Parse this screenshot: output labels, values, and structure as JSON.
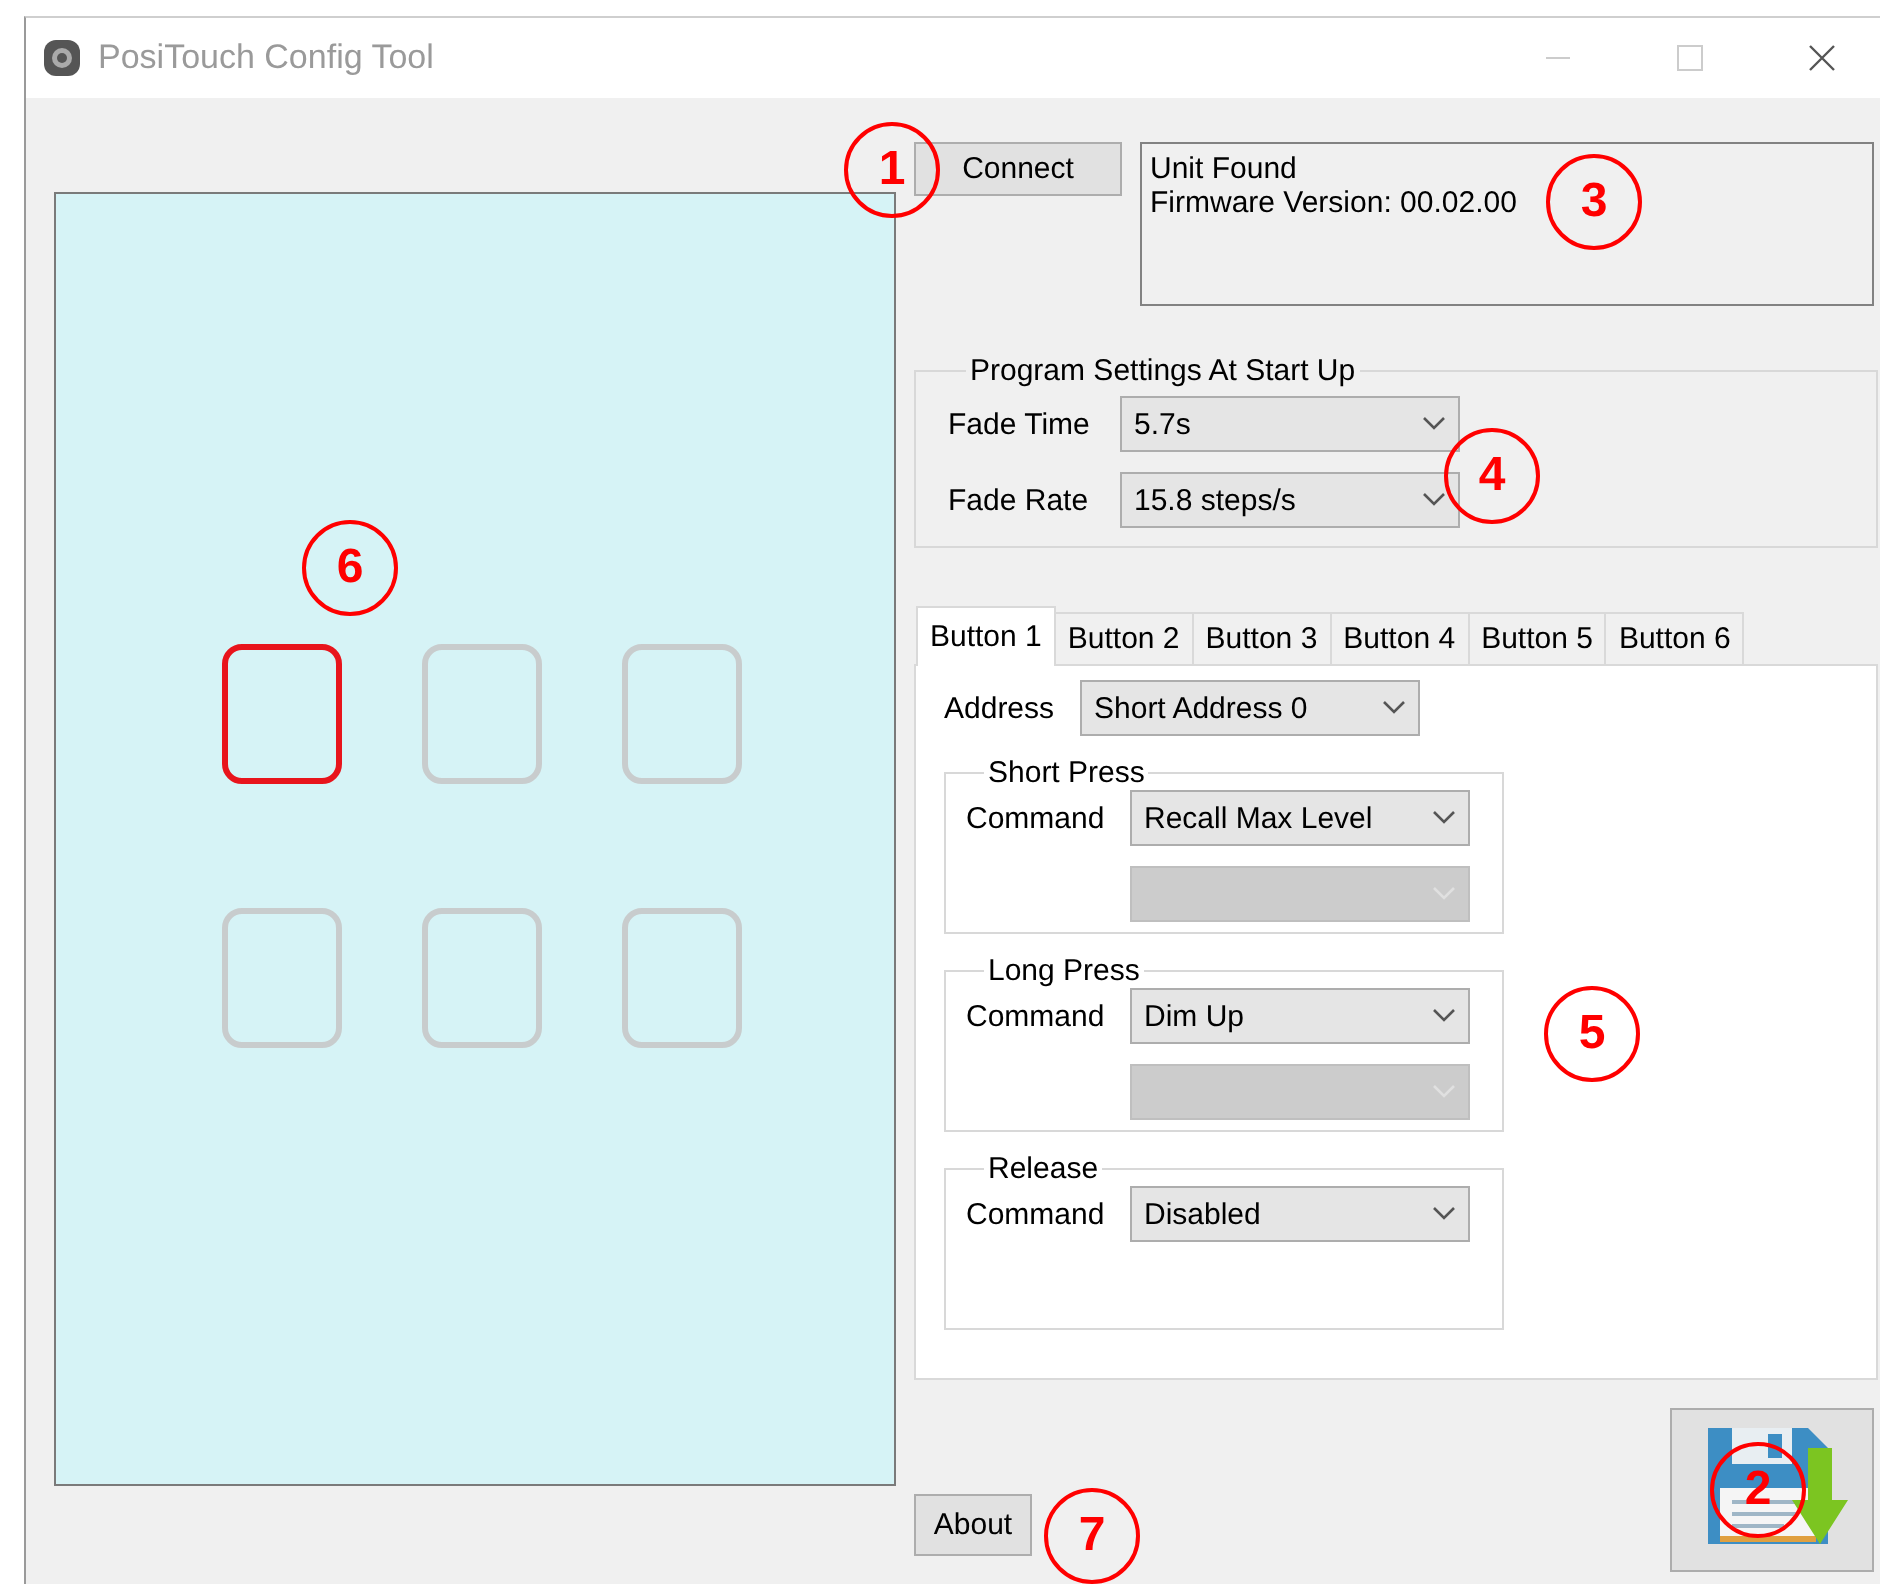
{
  "window": {
    "title": "PosiTouch Config Tool"
  },
  "preview": {
    "buttons": [
      {
        "selected": true
      },
      {
        "selected": false
      },
      {
        "selected": false
      },
      {
        "selected": false
      },
      {
        "selected": false
      },
      {
        "selected": false
      }
    ]
  },
  "connect_button": "Connect",
  "status": {
    "lines": [
      "Unit Found",
      "Firmware Version: 00.02.00"
    ]
  },
  "startup": {
    "title": "Program Settings At Start Up",
    "fields": [
      {
        "label": "Fade Time",
        "value": "5.7s"
      },
      {
        "label": "Fade Rate",
        "value": "15.8 steps/s"
      }
    ]
  },
  "tabs": [
    {
      "label": "Button 1",
      "selected": true
    },
    {
      "label": "Button 2",
      "selected": false
    },
    {
      "label": "Button 3",
      "selected": false
    },
    {
      "label": "Button 4",
      "selected": false
    },
    {
      "label": "Button 5",
      "selected": false
    },
    {
      "label": "Button 6",
      "selected": false
    }
  ],
  "address": {
    "label": "Address",
    "value": "Short Address 0"
  },
  "press_groups": [
    {
      "title": "Short Press",
      "label": "Command",
      "value": "Recall Max Level",
      "secondary": {
        "disabled": true
      }
    },
    {
      "title": "Long Press",
      "label": "Command",
      "value": "Dim Up",
      "secondary": {
        "disabled": true
      }
    },
    {
      "title": "Release",
      "label": "Command",
      "value": "Disabled"
    }
  ],
  "about_button": "About",
  "callouts": [
    {
      "number": "1"
    },
    {
      "number": "3"
    },
    {
      "number": "4"
    },
    {
      "number": "6"
    },
    {
      "number": "5"
    },
    {
      "number": "2"
    },
    {
      "number": "7"
    }
  ]
}
